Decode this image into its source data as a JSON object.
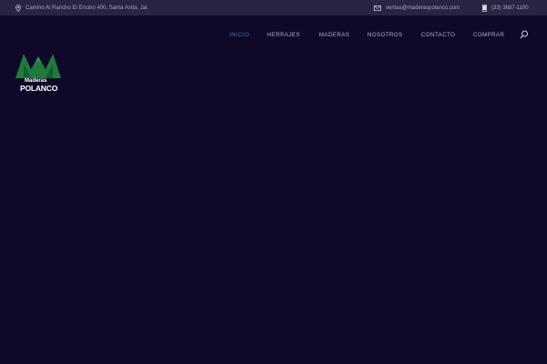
{
  "topbar": {
    "address": "Camino Al Rancho El Encino 400, Santa Anita, Jal.",
    "email": "ventas@maderaspolanco.com",
    "phone": "(33) 3687-1100"
  },
  "nav": {
    "items": [
      {
        "label": "INICIO",
        "active": true
      },
      {
        "label": "HERRAJES",
        "active": false
      },
      {
        "label": "MADERAS",
        "active": false
      },
      {
        "label": "NOSOTROS",
        "active": false
      },
      {
        "label": "CONTACTO",
        "active": false
      },
      {
        "label": "COMPRAR",
        "active": false
      }
    ],
    "search_icon": "search-icon"
  },
  "logo": {
    "line1": "Maderas",
    "line2": "POLANCO"
  },
  "colors": {
    "background": "#0f0829",
    "topbar": "#2b2342",
    "active_nav": "#3f7fa3",
    "logo_green": "#1f7a3d"
  }
}
